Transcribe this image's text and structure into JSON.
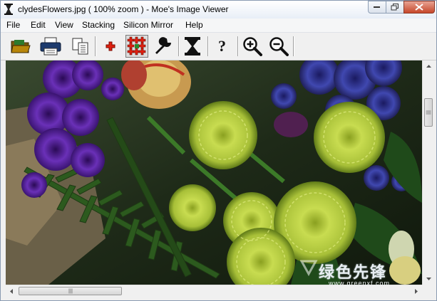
{
  "window": {
    "title": "clydesFlowers.jpg ( 100% zoom ) - Moe's Image Viewer"
  },
  "menu": [
    {
      "label": "File"
    },
    {
      "label": "Edit"
    },
    {
      "label": "View"
    },
    {
      "label": "Stacking"
    },
    {
      "label": "Silicon Mirror"
    },
    {
      "label": "Help"
    }
  ],
  "toolbar": {
    "buttons": [
      {
        "icon": "open-folder-icon"
      },
      {
        "icon": "print-icon"
      },
      {
        "icon": "copy-icon"
      },
      {
        "icon": "single-point-icon"
      },
      {
        "icon": "multi-point-grid-icon",
        "active": true
      },
      {
        "icon": "wrench-icon"
      },
      {
        "icon": "hourglass-stack-icon"
      },
      {
        "icon": "help-question-icon",
        "glyph": "?"
      },
      {
        "icon": "zoom-in-icon"
      },
      {
        "icon": "zoom-out-icon"
      }
    ]
  },
  "watermark": {
    "text": "绿色先锋",
    "url": "www.greenxf.com"
  },
  "colors": {
    "accent_red": "#e02010",
    "chrysanthemum": "#b8d040",
    "violet": "#5a2aa0",
    "close_button": "#c7472a"
  }
}
